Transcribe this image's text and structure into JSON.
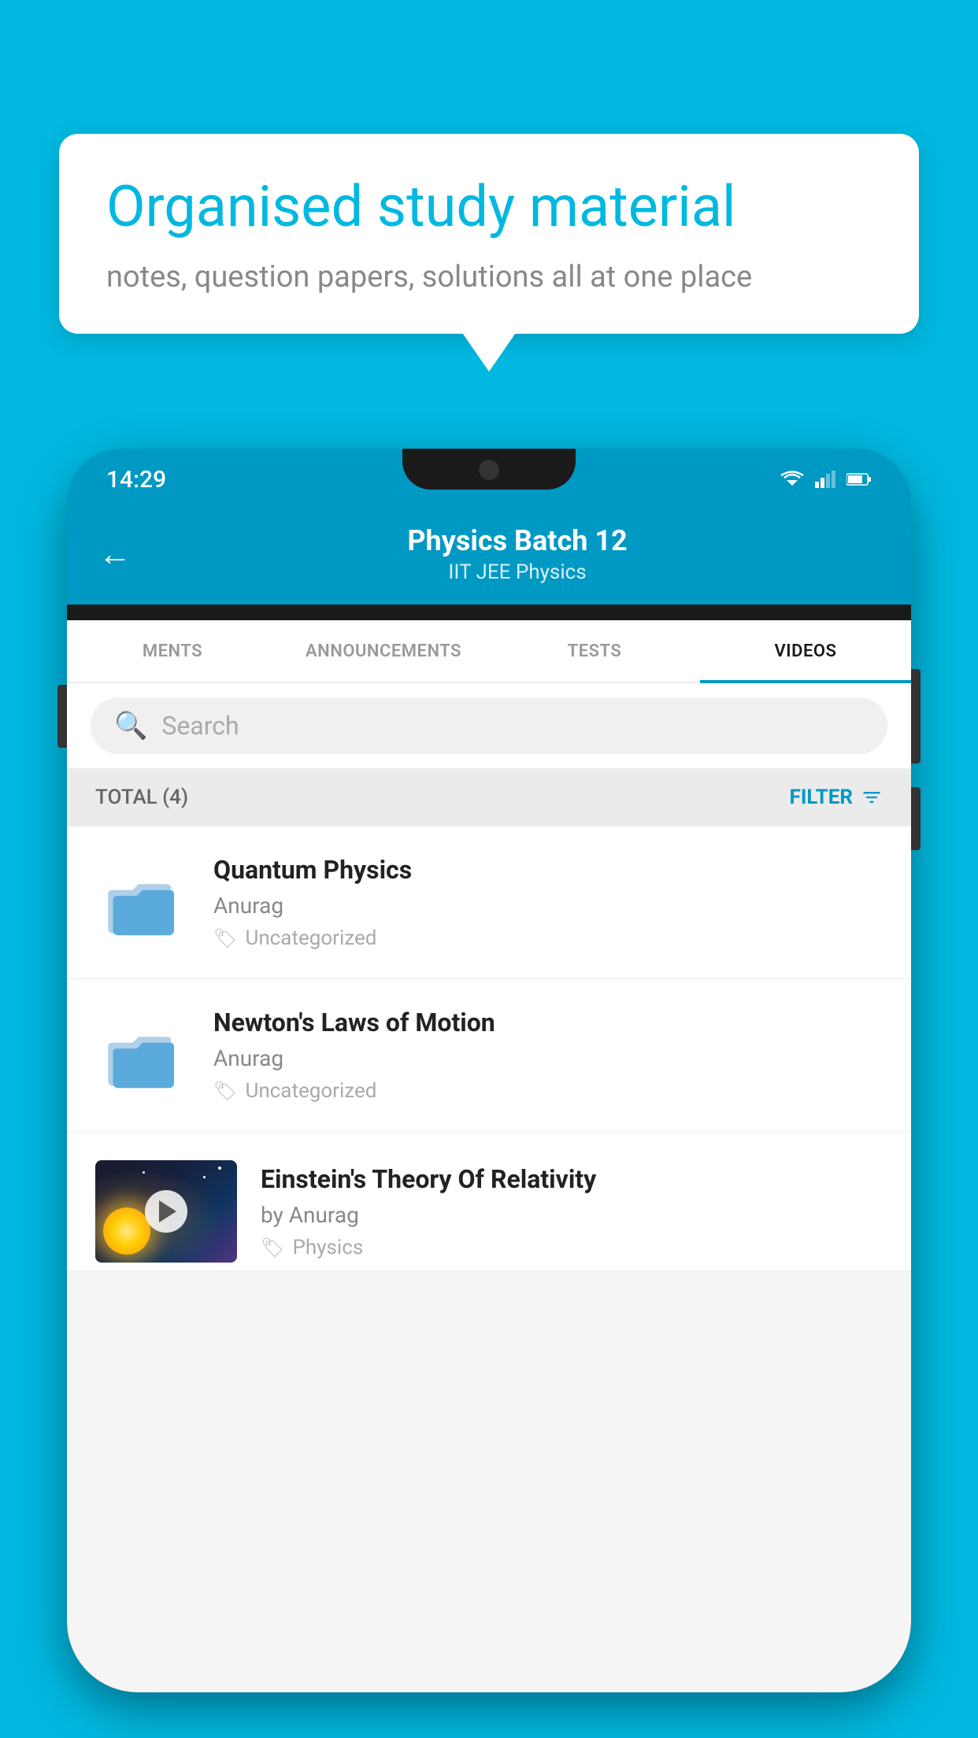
{
  "background": {
    "color": "#00b8e0"
  },
  "speech_bubble": {
    "title": "Organised study material",
    "subtitle": "notes, question papers, solutions all at one place"
  },
  "status_bar": {
    "time": "14:29"
  },
  "header": {
    "title": "Physics Batch 12",
    "subtitle": "IIT JEE   Physics",
    "back_label": "←"
  },
  "tabs": [
    {
      "label": "MENTS",
      "active": false
    },
    {
      "label": "ANNOUNCEMENTS",
      "active": false
    },
    {
      "label": "TESTS",
      "active": false
    },
    {
      "label": "VIDEOS",
      "active": true
    }
  ],
  "search": {
    "placeholder": "Search"
  },
  "filter": {
    "total_label": "TOTAL (4)",
    "filter_label": "FILTER"
  },
  "videos": [
    {
      "title": "Quantum Physics",
      "author": "Anurag",
      "tag": "Uncategorized",
      "type": "folder"
    },
    {
      "title": "Newton's Laws of Motion",
      "author": "Anurag",
      "tag": "Uncategorized",
      "type": "folder"
    },
    {
      "title": "Einstein's Theory Of Relativity",
      "author": "by Anurag",
      "tag": "Physics",
      "type": "video"
    }
  ]
}
